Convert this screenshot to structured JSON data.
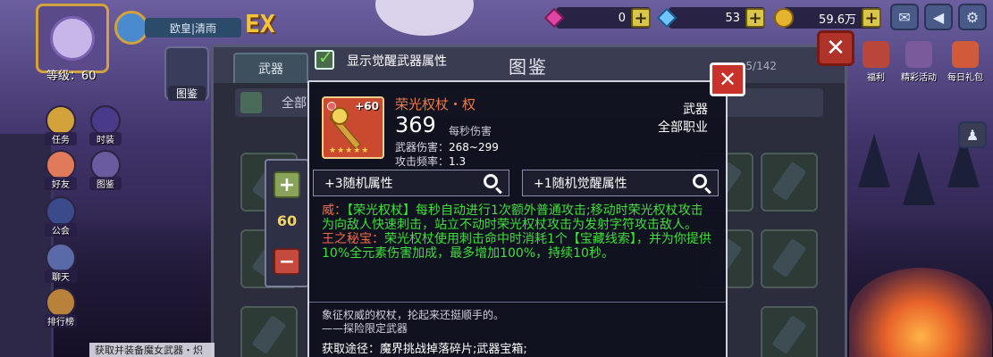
{
  "player": {
    "level_label": "等级：60",
    "name": "欧皇|清雨"
  },
  "logo": "EX",
  "resources": [
    {
      "icon": "pink-gem-icon",
      "value": "0"
    },
    {
      "icon": "blue-gem-icon",
      "value": "53"
    },
    {
      "icon": "gold-coin-icon",
      "value": "59.6万"
    }
  ],
  "right_menu": [
    {
      "label": "福利"
    },
    {
      "label": "精彩活动"
    },
    {
      "label": "每日礼包"
    }
  ],
  "left_menu": [
    {
      "label": "任务"
    },
    {
      "label": "时装"
    },
    {
      "label": "好友"
    },
    {
      "label": "图鉴"
    },
    {
      "label": "公会"
    },
    {
      "label": "聊天"
    },
    {
      "label": "排行榜"
    }
  ],
  "mini_menu_label": "图鉴",
  "catalog": {
    "title": "图鉴",
    "tab_weapon": "武器",
    "count": "5/142",
    "filter_all": "全部"
  },
  "awaken_toggle": {
    "label": "显示觉醒武器属性",
    "checked": true
  },
  "quantity": {
    "value": "60",
    "plus": "+",
    "minus": "−"
  },
  "item": {
    "level_badge": "+60",
    "stars": "★★★★★",
    "name": "荣光权杖・权",
    "dps": "369",
    "dps_label": "每秒伤害",
    "damage_label": "武器伤害：",
    "damage_value": "268~299",
    "rate_label": "攻击频率：",
    "rate_value": "1.3",
    "type": "武器",
    "job": "全部职业",
    "random_attr_btn": "+3随机属性",
    "awaken_attr_btn": "+1随机觉醒属性",
    "skill1_name": "威：",
    "skill1_text": "【荣光权杖】每秒自动进行1次额外普通攻击;移动时荣光权杖攻击为向敌人快速刺击，站立不动时荣光权杖攻击为发射字符攻击敌人。",
    "skill2_name": "王之秘宝：",
    "skill2_text": "荣光权杖使用刺击命中时消耗1个【宝藏线索】，并为你提供10%全元素伤害加成，最多增加100%，持续10秒。",
    "flavor_line1": "象征权威的权杖，抡起来还挺顺手的。",
    "flavor_line2": "——探险限定武器",
    "source": "获取途径：魔界挑战掉落碎片;武器宝箱;"
  },
  "close_popup": "✕",
  "close_main": "✕",
  "bottom_ticker": "获取并装备魔女武器・炽"
}
